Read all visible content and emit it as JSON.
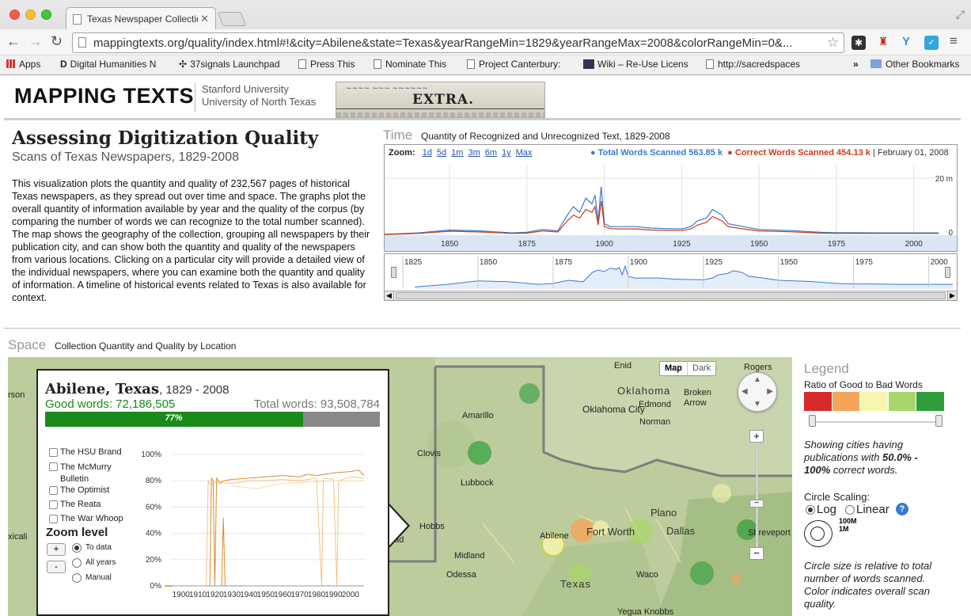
{
  "browser": {
    "tab_title": "Texas Newspaper Collectio",
    "url": "mappingtexts.org/quality/index.html#!&city=Abilene&state=Texas&yearRangeMin=1829&yearRangeMax=2008&colorRangeMin=0&...",
    "bookmarks": [
      "Apps",
      "Digital Humanities N",
      "37signals Launchpad",
      "Press This",
      "Nominate This",
      "Project Canterbury: ",
      "Wiki – Re-Use Licens",
      "http://sacredspaces",
      "Other Bookmarks"
    ]
  },
  "header": {
    "title": "MAPPING TEXTS",
    "org1": "Stanford University",
    "org2": "University of North Texas",
    "newspaper_text": "EXTRA."
  },
  "intro": {
    "heading": "Assessing Digitization Quality",
    "subheading": "Scans of Texas Newspapers, 1829-2008",
    "body": "This visualization plots the quantity and quality of 232,567 pages of historical Texas newspapers, as they spread out over time and space. The graphs plot the overall quantity of information available by year and the quality of the corpus (by comparing the number of words we can recognize to the total number scanned). The map shows the geography of the collection, grouping all newspapers by their publication city, and can show both the quantity and quality of the newspapers from various locations. Clicking on a particular city will provide a detailed view of the individual newspapers, where you can examine both the quantity and quality of information. A timeline of historical events related to Texas is also available for context."
  },
  "time": {
    "label": "Time",
    "subtitle": "Quantity of Recognized and Unrecognized Text, 1829-2008",
    "zoom_label": "Zoom:",
    "zoom_options": [
      "1d",
      "5d",
      "1m",
      "3m",
      "6m",
      "1y",
      "Max"
    ],
    "total_label": "Total Words Scanned 563.85 k",
    "correct_label": "Correct Words Scanned 454.13 k",
    "date_label": "| February 01, 2008",
    "y_ticks": [
      "20 m",
      "0"
    ],
    "x_ticks": [
      "1850",
      "1875",
      "1900",
      "1925",
      "1950",
      "1975",
      "2000"
    ],
    "nav_ticks": [
      "1825",
      "1850",
      "1875",
      "1900",
      "1925",
      "1950",
      "1975",
      "2000"
    ],
    "colors": {
      "total": "#3a7ad0",
      "correct": "#cc3a1a"
    }
  },
  "chart_data": {
    "type": "line",
    "x": [
      1829,
      1840,
      1850,
      1860,
      1870,
      1875,
      1880,
      1885,
      1888,
      1890,
      1892,
      1894,
      1896,
      1897,
      1898,
      1899,
      1900,
      1902,
      1905,
      1910,
      1915,
      1920,
      1925,
      1928,
      1930,
      1933,
      1935,
      1938,
      1940,
      1945,
      1950,
      1960,
      1970,
      1975,
      1980,
      1990,
      2000,
      2008
    ],
    "series": [
      {
        "name": "Total Words Scanned",
        "values": [
          0.3,
          0.8,
          1.8,
          1.5,
          0.8,
          1.0,
          2.0,
          1.5,
          7.0,
          10,
          8,
          13,
          11,
          14,
          5,
          17,
          4,
          3,
          3,
          3,
          2.5,
          2.3,
          2.2,
          3,
          5,
          6,
          9,
          7,
          4,
          3,
          2,
          1.6,
          1,
          0.9,
          0.9,
          0.8,
          0.8,
          0.8
        ]
      },
      {
        "name": "Correct Words Scanned",
        "values": [
          0.2,
          0.6,
          1.4,
          1.1,
          0.6,
          0.7,
          1.5,
          1.1,
          5,
          7,
          6,
          9,
          8,
          10,
          3.5,
          12,
          3,
          2.3,
          2.2,
          2.2,
          1.8,
          1.7,
          1.6,
          2.2,
          3.5,
          4.5,
          6.5,
          5,
          3,
          2.2,
          1.5,
          1.2,
          0.7,
          0.6,
          0.6,
          0.6,
          0.6,
          0.6
        ]
      }
    ],
    "xlabel": "",
    "ylabel": "",
    "y_unit": "millions of words",
    "ylim": [
      0,
      25
    ]
  },
  "space": {
    "label": "Space",
    "subtitle": "Collection Quantity and Quality by Location",
    "map_type_buttons": [
      "Map",
      "Dark"
    ],
    "cities": [
      "Enid",
      "Rogers",
      "Oklahoma",
      "Oklahoma City",
      "Edmond",
      "Broken Arrow",
      "Norman",
      "Amarillo",
      "Clovis",
      "Lubbock",
      "Hobbs",
      "Midland",
      "Odessa",
      "Plano",
      "Dallas",
      "Fort Worth",
      "Abilene",
      "Shreveport",
      "Waco",
      "Texas",
      "Yegua Knobbs",
      "rson",
      "xicali",
      "bad"
    ]
  },
  "popup": {
    "city": "Abilene, Texas",
    "years": ", 1829 - 2008",
    "good_words": "Good words: 72,186,505",
    "total_words": "Total words: 93,508,784",
    "percent_label": "77%",
    "percent_value": 0.77,
    "papers": [
      "The HSU Brand",
      "The McMurry Bulletin",
      "The Optimist",
      "The Reata",
      "The War Whoop"
    ],
    "zoom_title": "Zoom level",
    "zoom_in": "+",
    "zoom_out": "-",
    "zoom_options": [
      "To data",
      "All years",
      "Manual"
    ],
    "chart_y_ticks": [
      "100%",
      "80%",
      "60%",
      "40%",
      "20%",
      "0%"
    ],
    "chart_x_ticks": [
      "1900",
      "1910",
      "1920",
      "1930",
      "1940",
      "1950",
      "1960",
      "1970",
      "1980",
      "1990",
      "2000"
    ]
  },
  "legend": {
    "title": "Legend",
    "ratio_label": "Ratio of Good to Bad Words",
    "swatches": [
      "#d62a2a",
      "#f5a55a",
      "#f7f5b0",
      "#a9d66a",
      "#2f9e3a"
    ],
    "showing_1": "Showing cities having publications with ",
    "showing_range": "50.0% - 100%",
    "showing_2": " correct words.",
    "scaling_label": "Circle Scaling:",
    "scale_log": "Log",
    "scale_linear": "Linear",
    "help": "?",
    "size_100m": "100M",
    "size_1m": "1M",
    "note": "Circle size is relative to total number of words scanned. Color indicates overall scan quality."
  }
}
